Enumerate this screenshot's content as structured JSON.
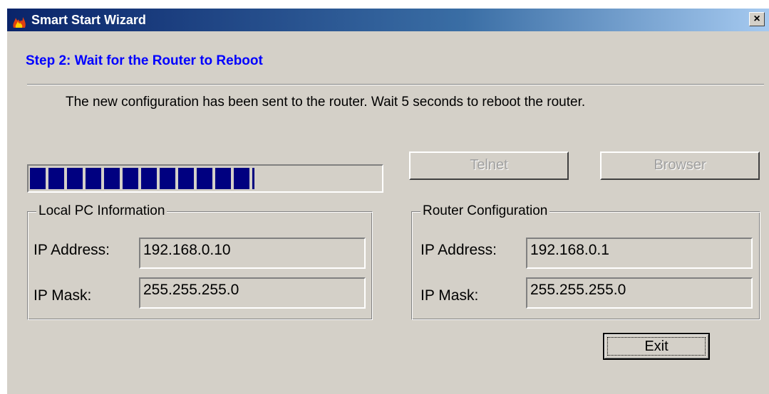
{
  "window": {
    "title": "Smart Start Wizard",
    "close_label": "×",
    "icon": "fire-icon"
  },
  "step_title": "Step 2: Wait for the Router to Reboot",
  "message": "The new configuration has been sent to the router. Wait 5 seconds to reboot the router.",
  "progress": {
    "segments_filled": 12,
    "fraction": 0.64,
    "color": "#000080"
  },
  "buttons": {
    "telnet": "Telnet",
    "browser": "Browser",
    "exit": "Exit"
  },
  "local_pc": {
    "title": "Local PC Information",
    "ip_label": "IP Address:",
    "ip_value": "192.168.0.10",
    "mask_label": "IP Mask:",
    "mask_value": "255.255.255.0"
  },
  "router": {
    "title": "Router Configuration",
    "ip_label": "IP Address:",
    "ip_value": "192.168.0.1",
    "mask_label": "IP Mask:",
    "mask_value": "255.255.255.0"
  },
  "colors": {
    "title_gradient_start": "#0a246a",
    "step_title": "#0000ff",
    "face": "#d4d0c8"
  }
}
